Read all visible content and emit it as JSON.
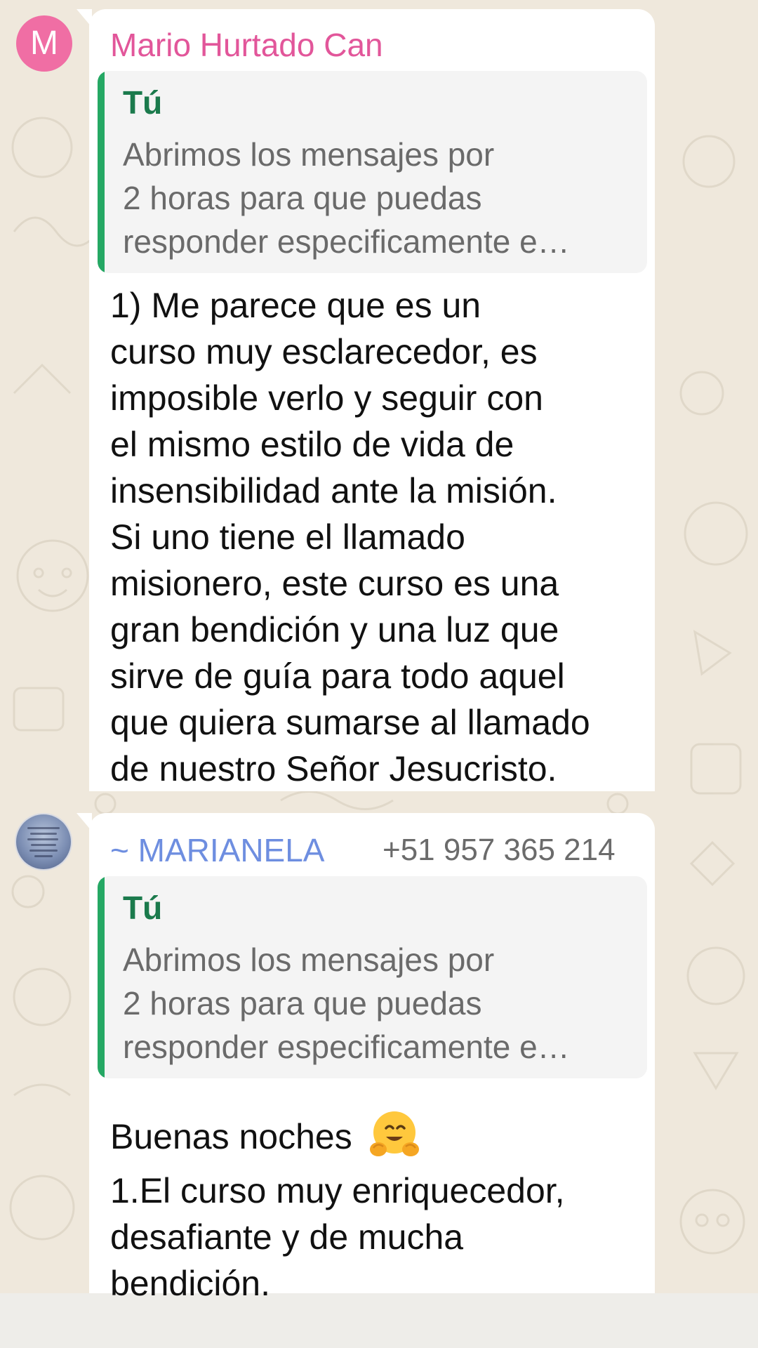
{
  "chat": {
    "messages": [
      {
        "avatar_letter": "M",
        "sender": "Mario Hurtado Can",
        "quote": {
          "author": "Tú",
          "text": "Abrimos los mensajes por\n2 horas para que puedas\nresponder especificamente e…"
        },
        "text": "1) Me parece que es un\ncurso muy esclarecedor, es\nimposible verlo y seguir con\nel mismo estilo de vida de\ninsensibilidad ante la misión.\nSi uno tiene el llamado\nmisionero, este curso es una\ngran bendición y una luz que\nsirve de guía para todo aquel\nque quiera sumarse al llamado\nde nuestro Señor Jesucristo."
      },
      {
        "sender": "~ MARIANELA",
        "phone": "+51 957 365 214",
        "quote": {
          "author": "Tú",
          "text": "Abrimos los mensajes por\n2 horas para que puedas\nresponder especificamente e…"
        },
        "greeting": "Buenas noches",
        "emoji": "hugging-face-emoji",
        "text": "1.El curso muy enriquecedor,\ndesafiante y de mucha\nbendición."
      }
    ]
  },
  "colors": {
    "wallpaper": "#efe8dc",
    "bubble": "#ffffff",
    "quote_bar": "#25a864",
    "quote_author": "#1b7a4c",
    "sender_1": "#e2569a",
    "sender_2": "#6e8ee0",
    "avatar_1": "#f06ea4"
  }
}
